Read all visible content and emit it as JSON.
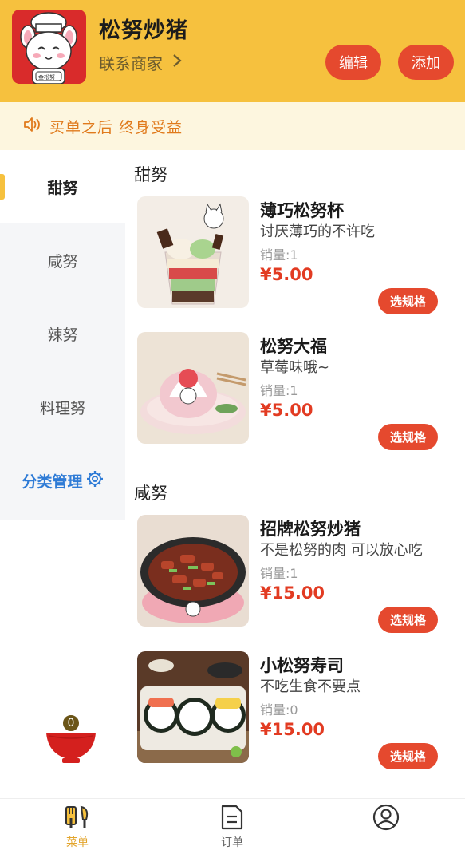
{
  "header": {
    "store_name": "松努炒猪",
    "contact_label": "联系商家",
    "edit_label": "编辑",
    "add_label": "添加",
    "logo_badge": "金松努"
  },
  "notice": {
    "text": "买单之后 终身受益"
  },
  "sidebar": {
    "categories": [
      {
        "label": "甜努"
      },
      {
        "label": "咸努"
      },
      {
        "label": "辣努"
      },
      {
        "label": "料理努"
      }
    ],
    "manage_label": "分类管理"
  },
  "sections": [
    {
      "title": "甜努",
      "items": [
        {
          "name": "薄巧松努杯",
          "desc": "讨厌薄巧的不许吃",
          "sales": "销量:1",
          "price": "¥5.00",
          "button": "选规格"
        },
        {
          "name": "松努大福",
          "desc": "草莓味哦~",
          "sales": "销量:1",
          "price": "¥5.00",
          "button": "选规格"
        }
      ]
    },
    {
      "title": "咸努",
      "items": [
        {
          "name": "招牌松努炒猪",
          "desc": "不是松努的肉 可以放心吃",
          "sales": "销量:1",
          "price": "¥15.00",
          "button": "选规格"
        },
        {
          "name": "小松努寿司",
          "desc": "不吃生食不要点",
          "sales": "销量:0",
          "price": "¥15.00",
          "button": "选规格"
        }
      ]
    }
  ],
  "cart": {
    "count": "0"
  },
  "tabbar": {
    "tabs": [
      {
        "label": "菜单",
        "icon": "fork-knife-icon"
      },
      {
        "label": "订单",
        "icon": "document-icon"
      },
      {
        "label": "",
        "icon": "user-icon"
      }
    ]
  },
  "colors": {
    "brand_yellow": "#F6C13E",
    "button_red": "#E5492E",
    "price_red": "#E23B22",
    "notice_orange": "#E07A1C",
    "manage_blue": "#2E7BD6"
  }
}
